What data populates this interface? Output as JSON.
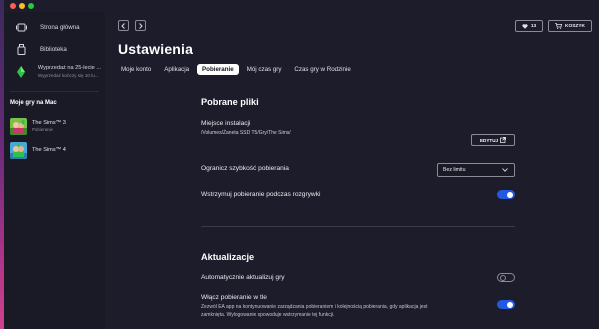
{
  "window": {
    "title": ""
  },
  "sidebar": {
    "items": [
      {
        "label": "Strona główna",
        "icon": "home-screen-icon"
      },
      {
        "label": "Biblioteka",
        "icon": "library-icon"
      }
    ],
    "sale": {
      "title": "Wyprzedaż na 25-lecie ...",
      "subtitle": "Wyprzedaż kończy się 10 lu...",
      "icon": "plumbob-icon"
    },
    "my_games_title": "Moje gry na Mac",
    "games": [
      {
        "name": "The Sims™ 3",
        "status": "Pobieranie"
      },
      {
        "name": "The Sims™ 4",
        "status": ""
      }
    ]
  },
  "header": {
    "back_icon": "chevron-left-icon",
    "forward_icon": "chevron-right-icon",
    "wishlist_count": "13",
    "cart_label": "KOSZYK"
  },
  "page": {
    "title": "Ustawienia",
    "tabs": [
      {
        "label": "Moje konto",
        "active": false
      },
      {
        "label": "Aplikacja",
        "active": false
      },
      {
        "label": "Pobieranie",
        "active": true
      },
      {
        "label": "Mój czas gry",
        "active": false
      },
      {
        "label": "Czas gry w Rodzinie",
        "active": false
      }
    ]
  },
  "downloads": {
    "heading": "Pobrane pliki",
    "install_location_label": "Miejsce instalacji",
    "install_location_path": "/Volumes/Żaneta SSD T5/Gry/The Sims/",
    "edit_label": "EDYTUJ",
    "speed_label": "Ogranicz szybkość pobierania",
    "speed_value": "Bez limitu",
    "pause_label": "Wstrzymuj pobieranie podczas rozgrywki",
    "pause_enabled": true
  },
  "updates": {
    "heading": "Aktualizacje",
    "auto_update_label": "Automatycznie aktualizuj gry",
    "auto_update_enabled": false,
    "background_label": "Włącz pobieranie w tle",
    "background_desc": "Zezwól EA app na kontynuowanie zarządzania pobieraniem i kolejnością pobierania, gdy aplikacja jest zamknięta. Wylogowanie spowoduje wstrzymanie tej funkcji.",
    "background_enabled": true
  },
  "colors": {
    "accent": "#2259e0",
    "background": "#1c1c2a",
    "sidebar": "#1a1a27"
  }
}
